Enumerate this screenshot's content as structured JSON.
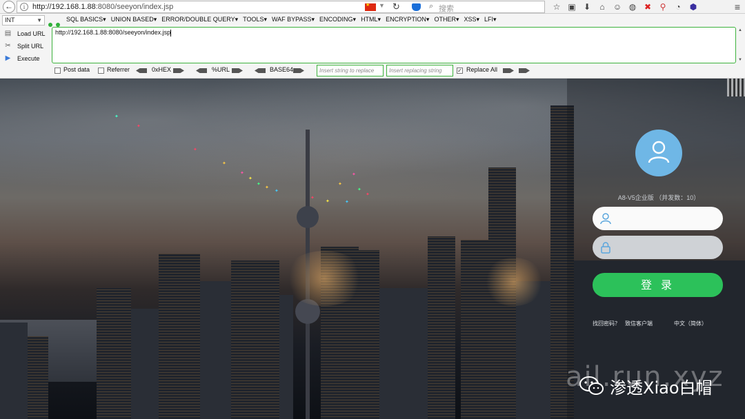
{
  "browser": {
    "url_host": "http://192.168.1.88",
    "url_rest": ":8080/seeyon/index.jsp",
    "search_placeholder": "搜索"
  },
  "hackbar": {
    "select_value": "INT",
    "menu": [
      "SQL BASICS▾",
      "UNION BASED▾",
      "ERROR/DOUBLE QUERY▾",
      "TOOLS▾",
      "WAF BYPASS▾",
      "ENCODING▾",
      "HTML▾",
      "ENCRYPTION▾",
      "OTHER▾",
      "XSS▾",
      "LFI▾"
    ],
    "load_url": "Load URL",
    "split_url": "Split URL",
    "execute": "Execute",
    "textarea_value": "http://192.168.1.88:8080/seeyon/index.jsp",
    "post_data": "Post data",
    "referrer": "Referrer",
    "enc_hex": "0xHEX",
    "enc_url": "%URL",
    "enc_base64": "BASE64",
    "insert_placeholder": "Insert string to replace",
    "replacing_placeholder": "Insert replacing string",
    "replace_all": "Replace All",
    "replace_all_checked": true,
    "post_data_checked": false,
    "referrer_checked": false
  },
  "login": {
    "version": "A8-V5企业版 （并发数：10）",
    "login_button": "登 录",
    "forgot_password": "找回密码？",
    "download_client": "致信客户端",
    "language": "中文（简体）"
  },
  "watermark": {
    "url_text": "ail.run.xyz",
    "brand": "渗透Xiao白帽"
  },
  "colors": {
    "accent_green": "#2cc15a",
    "avatar_blue": "#6fb7e6",
    "hackbar_border": "#3cb23c"
  }
}
